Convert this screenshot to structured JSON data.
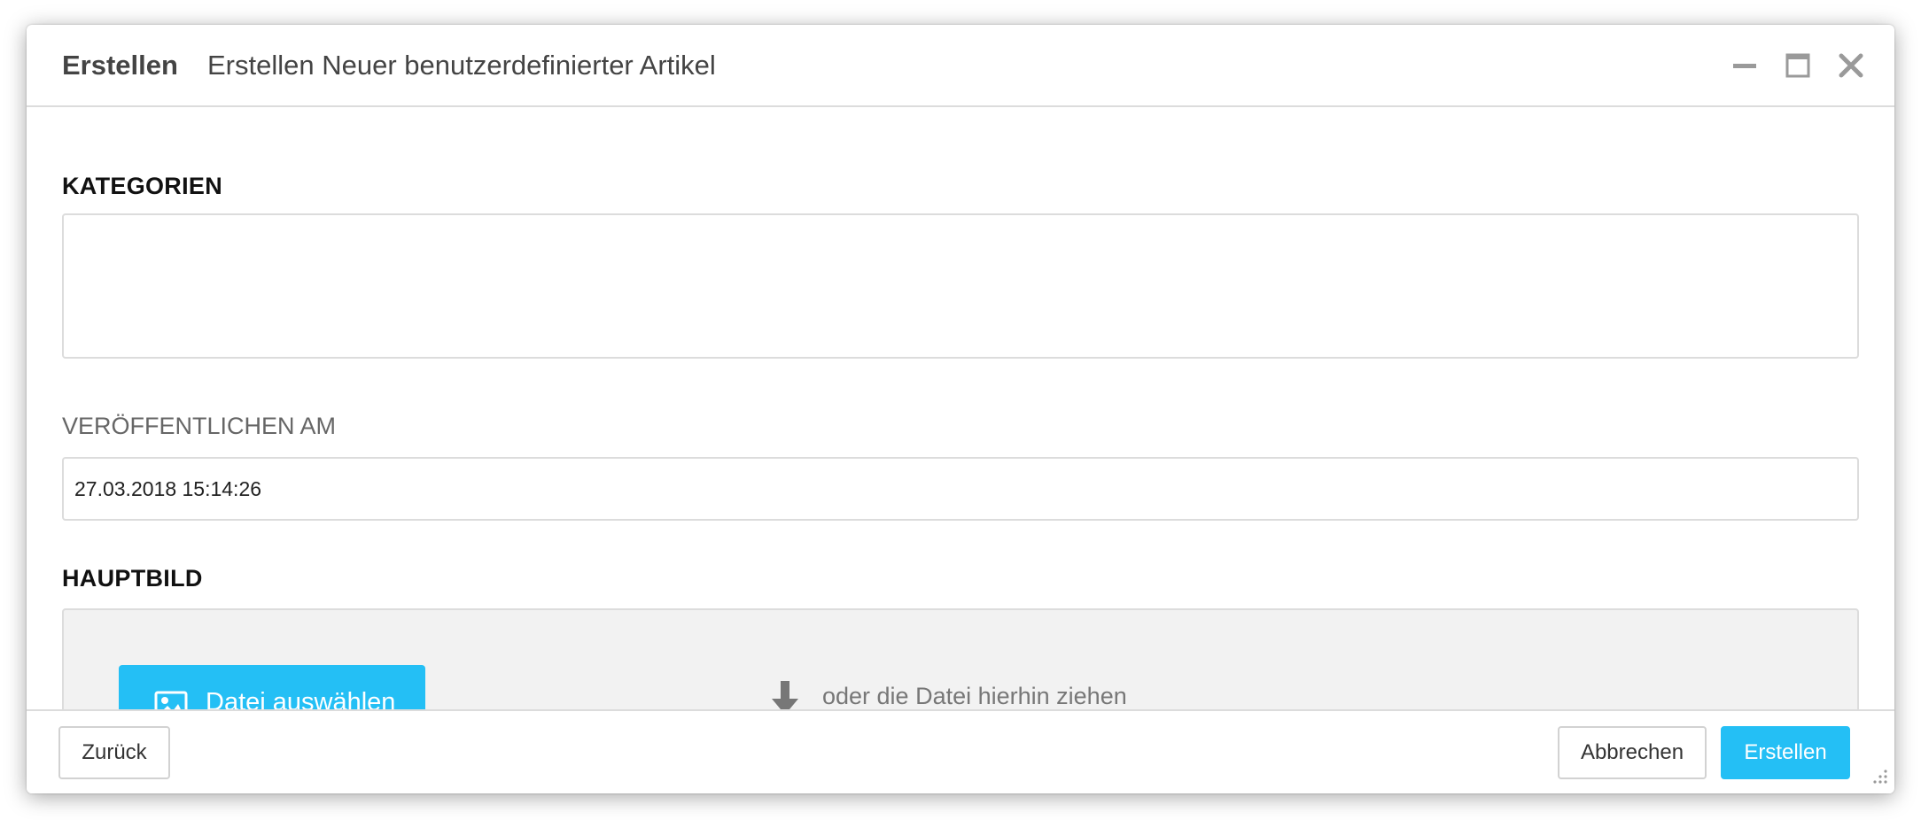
{
  "dialog": {
    "title": "Erstellen",
    "subtitle": "Erstellen Neuer benutzerdefinierter Artikel",
    "controls": {
      "minimize_icon": "minimize-icon",
      "maximize_icon": "maximize-icon",
      "close_icon": "close-icon"
    }
  },
  "form": {
    "categories": {
      "label": "KATEGORIEN",
      "value": ""
    },
    "publish_at": {
      "label": "VERÖFFENTLICHEN AM",
      "value": "27.03.2018 15:14:26"
    },
    "main_image": {
      "label": "HAUPTBILD",
      "choose_button": "Datei auswählen",
      "choose_icon": "image-icon",
      "drop_icon": "arrow-down-icon",
      "drop_hint": "oder die Datei hierhin ziehen"
    }
  },
  "footer": {
    "back_label": "Zurück",
    "cancel_label": "Abbrechen",
    "create_label": "Erstellen"
  },
  "colors": {
    "accent": "#24bff5",
    "border": "#dcdcdc",
    "dropzone_bg": "#f2f2f2"
  }
}
